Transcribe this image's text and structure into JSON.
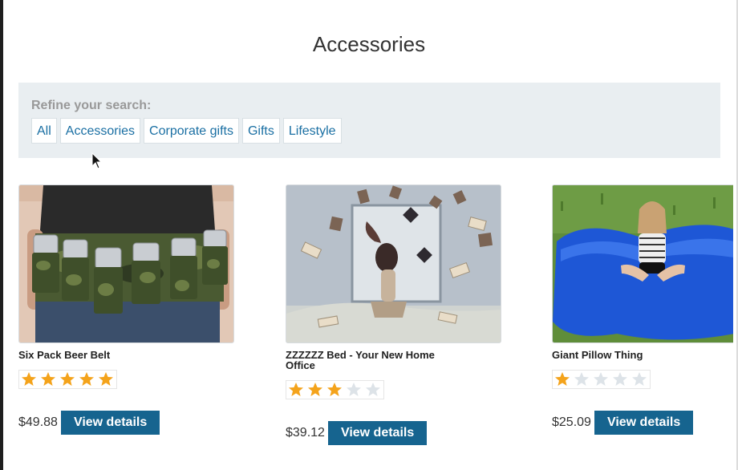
{
  "page": {
    "title": "Accessories"
  },
  "refine": {
    "label": "Refine your search:",
    "filters": [
      "All",
      "Accessories",
      "Corporate gifts",
      "Gifts",
      "Lifestyle"
    ]
  },
  "products": [
    {
      "name": "Six Pack Beer Belt",
      "rating": 5,
      "price": "$49.88",
      "button": "View details"
    },
    {
      "name": "ZZZZZZ Bed - Your New Home Office",
      "rating": 3,
      "price": "$39.12",
      "button": "View details"
    },
    {
      "name": "Giant Pillow Thing",
      "rating": 1,
      "price": "$25.09",
      "button": "View details"
    }
  ],
  "colors": {
    "star_on": "#f4a31b",
    "star_off": "#dde3e8",
    "button": "#16648f",
    "link": "#1a6fa3"
  }
}
